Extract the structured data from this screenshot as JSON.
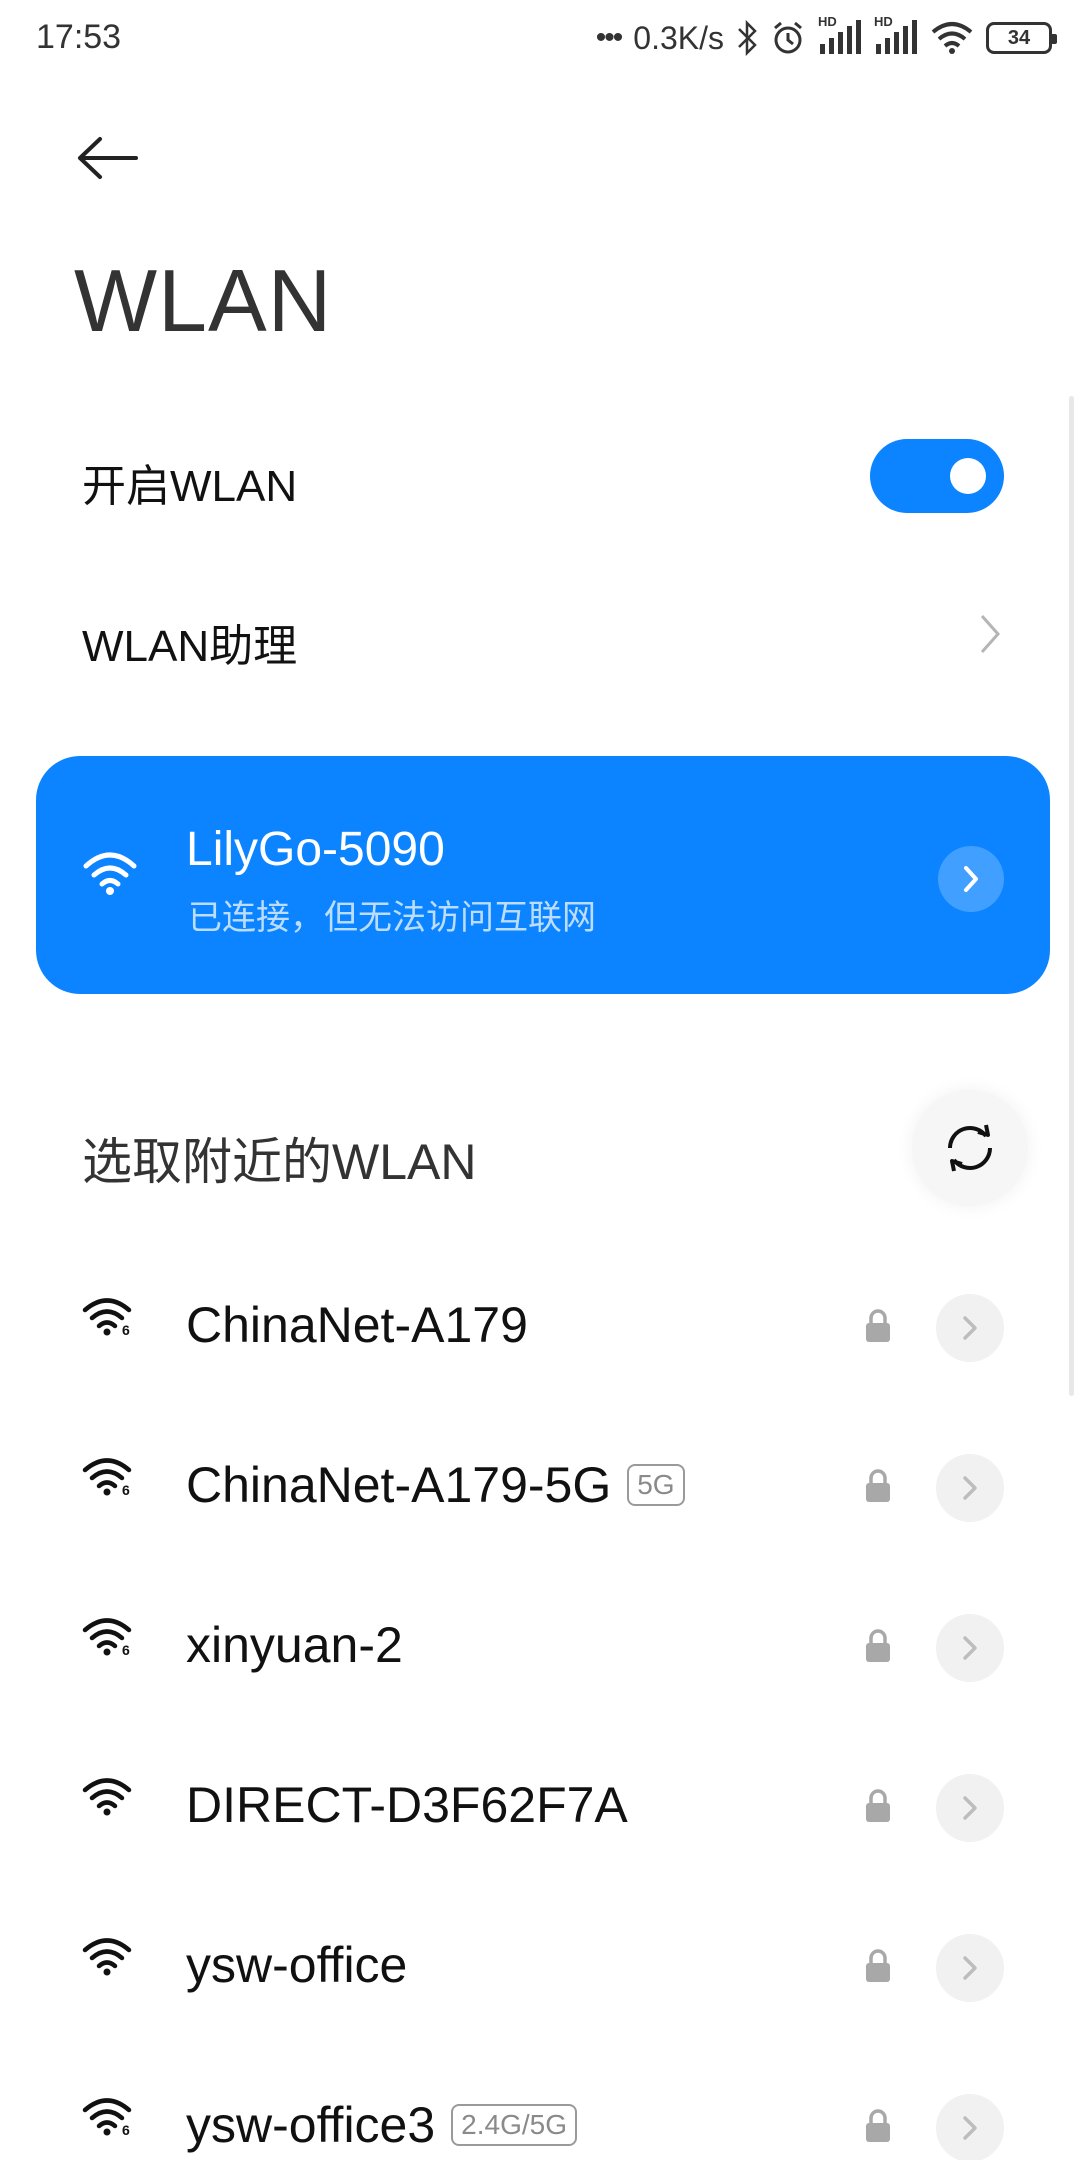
{
  "status_bar": {
    "time": "17:53",
    "net_speed": "0.3K/s",
    "signal_label_1": "HD",
    "signal_label_2": "HD",
    "battery": "34"
  },
  "header": {
    "title": "WLAN"
  },
  "settings": {
    "enable_label": "开启WLAN",
    "enable_on": true,
    "assistant_label": "WLAN助理"
  },
  "connected": {
    "ssid": "LilyGo-5090",
    "status": "已连接，但无法访问互联网"
  },
  "nearby": {
    "section_title": "选取附近的WLAN",
    "networks": [
      {
        "ssid": "ChinaNet-A179",
        "badge": "",
        "wifi6": true,
        "secured": true
      },
      {
        "ssid": "ChinaNet-A179-5G",
        "badge": "5G",
        "wifi6": true,
        "secured": true
      },
      {
        "ssid": "xinyuan-2",
        "badge": "",
        "wifi6": true,
        "secured": true
      },
      {
        "ssid": "DIRECT-D3F62F7A",
        "badge": "",
        "wifi6": false,
        "secured": true
      },
      {
        "ssid": "ysw-office",
        "badge": "",
        "wifi6": false,
        "secured": true
      },
      {
        "ssid": "ysw-office3",
        "badge": "2.4G/5G",
        "wifi6": true,
        "secured": true
      }
    ]
  },
  "colors": {
    "accent": "#0c84ff",
    "background": "#ffffff",
    "text": "#111111"
  },
  "icons": [
    "back-arrow-icon",
    "wifi-icon",
    "chevron-right-icon",
    "refresh-icon",
    "lock-icon",
    "bluetooth-icon",
    "alarm-icon",
    "battery-icon"
  ]
}
